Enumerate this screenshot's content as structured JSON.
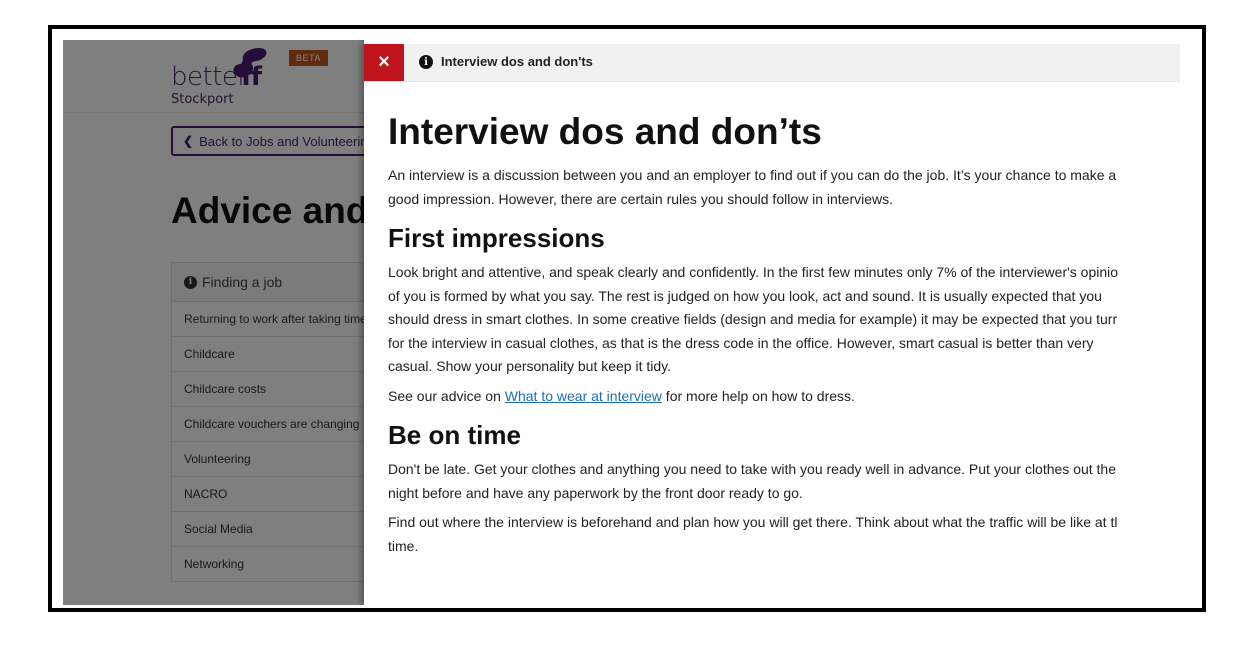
{
  "background_page": {
    "logo": {
      "line1": "better",
      "line1_off": "ff",
      "line2": "Stockport"
    },
    "beta_badge": "BETA",
    "back_button": "Back to Jobs and Volunteering",
    "page_title": "Advice and",
    "nav": {
      "header": "Finding a job",
      "items": [
        "Returning to work after taking time",
        "Childcare",
        "Childcare costs",
        "Childcare vouchers are changing",
        "Volunteering",
        "NACRO",
        "Social Media",
        "Networking"
      ]
    }
  },
  "panel": {
    "bar_title": "Interview dos and don'ts",
    "close_icon": "×",
    "info_icon": "i",
    "title": "Interview dos and don’ts",
    "intro": [
      "An interview is a discussion between you and an employer to find out if you can do the job. It’s your chance to make a",
      "good impression. However, there are certain rules you should follow in interviews."
    ],
    "sections": [
      {
        "heading": "First impressions",
        "para1": [
          "Look bright and attentive, and speak clearly and confidently. In the first few minutes only 7% of the interviewer's opinio",
          "of you is formed by what you say. The rest is judged on how you look, act and sound. It is usually expected that you",
          "should dress in smart clothes. In some creative fields (design and media for example) it may be expected that you turr",
          "for the interview in casual clothes, as that is the dress code in the office. However, smart casual is better than very",
          "casual. Show your personality but keep it tidy."
        ],
        "para2_before": "See our advice on ",
        "para2_link": "What to wear at interview",
        "para2_after": " for more help on how to dress."
      },
      {
        "heading": "Be on time",
        "para1": [
          "Don't be late. Get your clothes and anything you need to take with you ready well in advance. Put your clothes out the",
          "night before and have any paperwork by the front door ready to go."
        ],
        "para2": [
          "Find out where the interview is beforehand and plan how you will get there. Think about what the traffic will be like at tl",
          "time."
        ]
      }
    ]
  },
  "colors": {
    "brand_purple": "#4b1a72",
    "beta_orange": "#c4541c",
    "close_red": "#c0141c",
    "link_blue": "#1a6fb5"
  }
}
